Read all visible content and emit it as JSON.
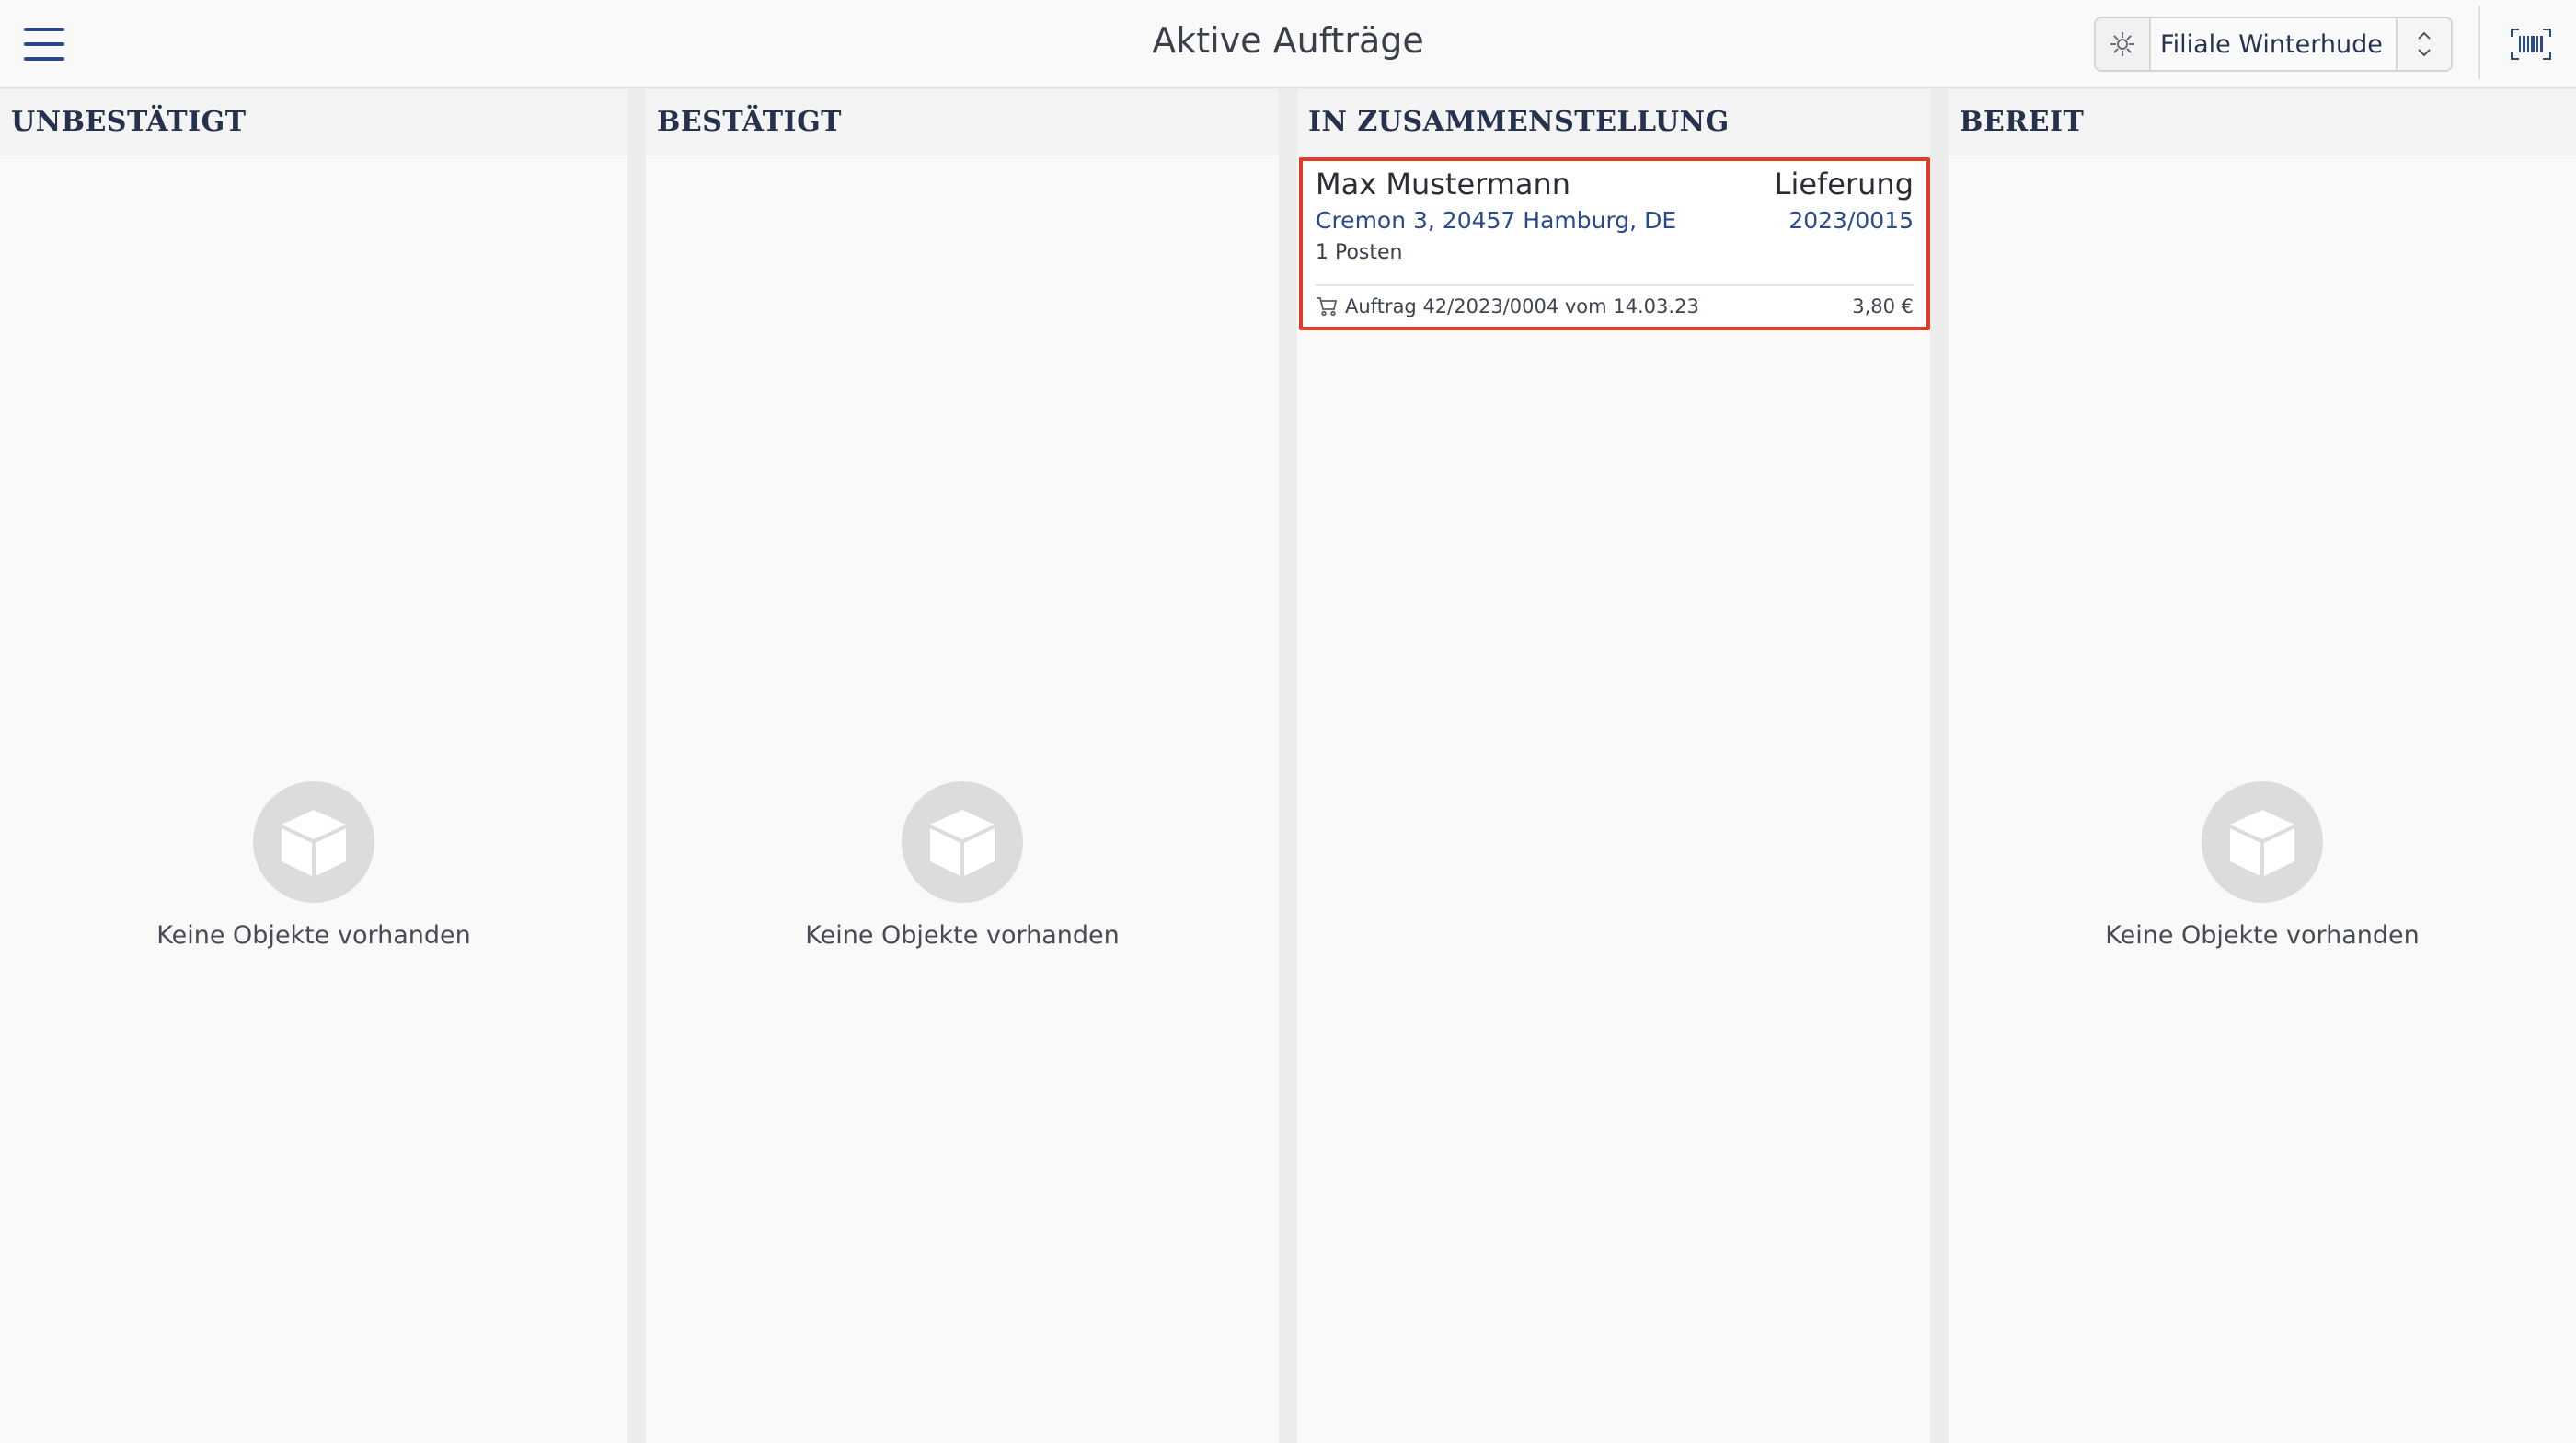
{
  "header": {
    "title": "Aktive Aufträge",
    "store": "Filiale Winterhude"
  },
  "columns": [
    {
      "title": "UNBESTÄTIGT",
      "empty_text": "Keine Objekte vorhanden"
    },
    {
      "title": "BESTÄTIGT",
      "empty_text": "Keine Objekte vorhanden"
    },
    {
      "title": "IN ZUSAMMENSTELLUNG"
    },
    {
      "title": "BEREIT",
      "empty_text": "Keine Objekte vorhanden"
    }
  ],
  "order_card": {
    "customer": "Max Mustermann",
    "type": "Lieferung",
    "address": "Cremon 3, 20457 Hamburg, DE",
    "number": "2023/0015",
    "items": "1 Posten",
    "reference": "Auftrag 42/2023/0004 vom 14.03.23",
    "total": "3,80 €"
  },
  "colors": {
    "accent": "#2b4a8a",
    "highlight": "#e23c26"
  },
  "icons": {
    "menu": "hamburger-menu-icon",
    "store": "store-gear-icon",
    "select": "chevron-up-down-icon",
    "barcode": "barcode-scanner-icon",
    "empty": "box-icon",
    "cart": "cart-icon"
  }
}
